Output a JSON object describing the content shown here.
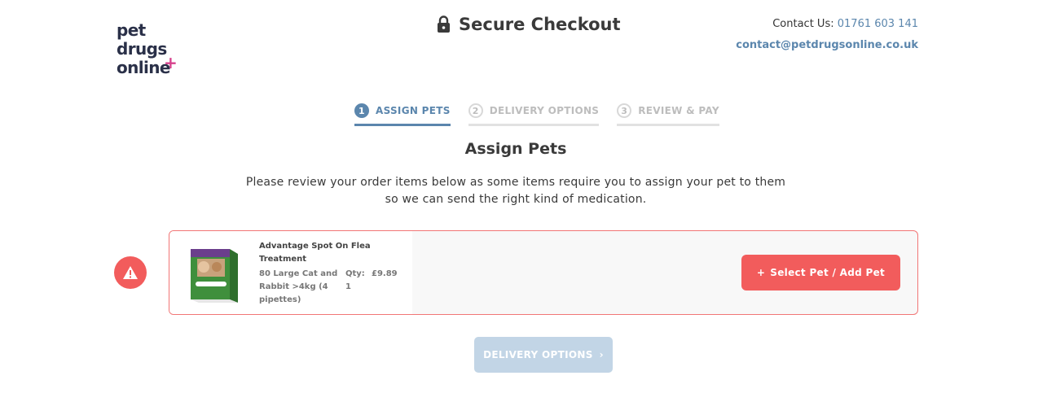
{
  "header": {
    "logo_lines": [
      "pet",
      "drugs",
      "online"
    ],
    "logo_plus": "+",
    "title": "Secure Checkout",
    "contact_label": "Contact Us:",
    "contact_phone": "01761 603 141",
    "contact_email": "contact@petdrugsonline.co.uk"
  },
  "steps": [
    {
      "number": "1",
      "label": "ASSIGN PETS",
      "active": true
    },
    {
      "number": "2",
      "label": "DELIVERY OPTIONS",
      "active": false
    },
    {
      "number": "3",
      "label": "REVIEW & PAY",
      "active": false
    }
  ],
  "main": {
    "heading": "Assign Pets",
    "intro_line1": "Please review your order items below as some items require you to assign your pet to them",
    "intro_line2": "so we can send the right kind of medication."
  },
  "order_item": {
    "name": "Advantage Spot On Flea Treatment",
    "variant": "80 Large Cat and Rabbit >4kg (4 pipettes)",
    "qty_label": "Qty:",
    "qty": "1",
    "price": "£9.89",
    "select_pet_label": "Select Pet / Add Pet",
    "select_pet_prefix": "+"
  },
  "footer": {
    "next_button": "DELIVERY OPTIONS",
    "next_chevron": "›"
  },
  "colors": {
    "brand_blue": "#5b86ad",
    "alert_red": "#f25c5c",
    "disabled_blue": "#c2d5e6"
  }
}
